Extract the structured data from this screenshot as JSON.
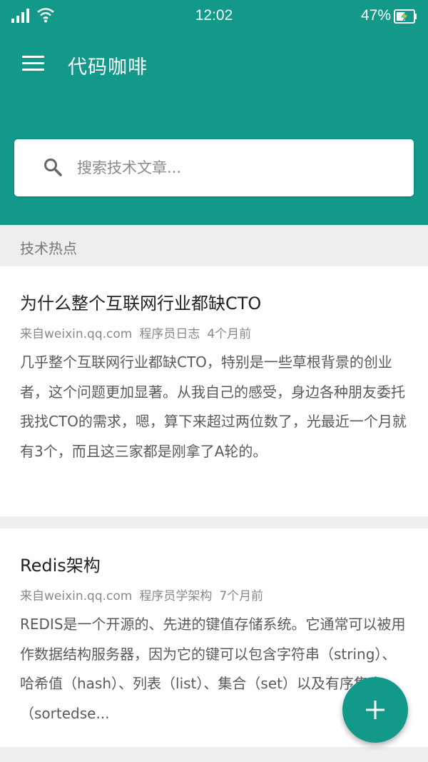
{
  "status_bar": {
    "time": "12:02",
    "battery_percent": "47%",
    "icons": [
      "signal-icon",
      "wifi-icon",
      "battery-charging-icon"
    ]
  },
  "toolbar": {
    "title": "代码咖啡",
    "menu_icon": "menu-icon"
  },
  "search": {
    "placeholder": "搜索技术文章...",
    "value": "",
    "icon": "search-icon"
  },
  "section": {
    "title": "技术热点"
  },
  "articles": [
    {
      "title": "为什么整个互联网行业都缺CTO",
      "source": "来自weixin.qq.com",
      "channel": "程序员日志",
      "time": "4个月前",
      "summary": "几乎整个互联网行业都缺CTO，特别是一些草根背景的创业者，这个问题更加显著。从我自己的感受，身边各种朋友委托我找CTO的需求，嗯，算下来超过两位数了，光最近一个月就有3个，而且这三家都是刚拿了A轮的。"
    },
    {
      "title": "Redis架构",
      "source": "来自weixin.qq.com",
      "channel": "程序员学架构",
      "time": "7个月前",
      "summary": "REDIS是一个开源的、先进的键值存储系统。它通常可以被用作数据结构服务器，因为它的键可以包含字符串（string）、哈希值（hash）、列表（list）、集合（set）以及有序集合（sortedse..."
    }
  ],
  "fab": {
    "icon": "plus-icon"
  },
  "colors": {
    "primary": "#12998a",
    "background": "#eeeeee",
    "card": "#ffffff",
    "title_text": "#222222",
    "meta_text": "#888888",
    "summary_text": "#5a5a5a"
  }
}
